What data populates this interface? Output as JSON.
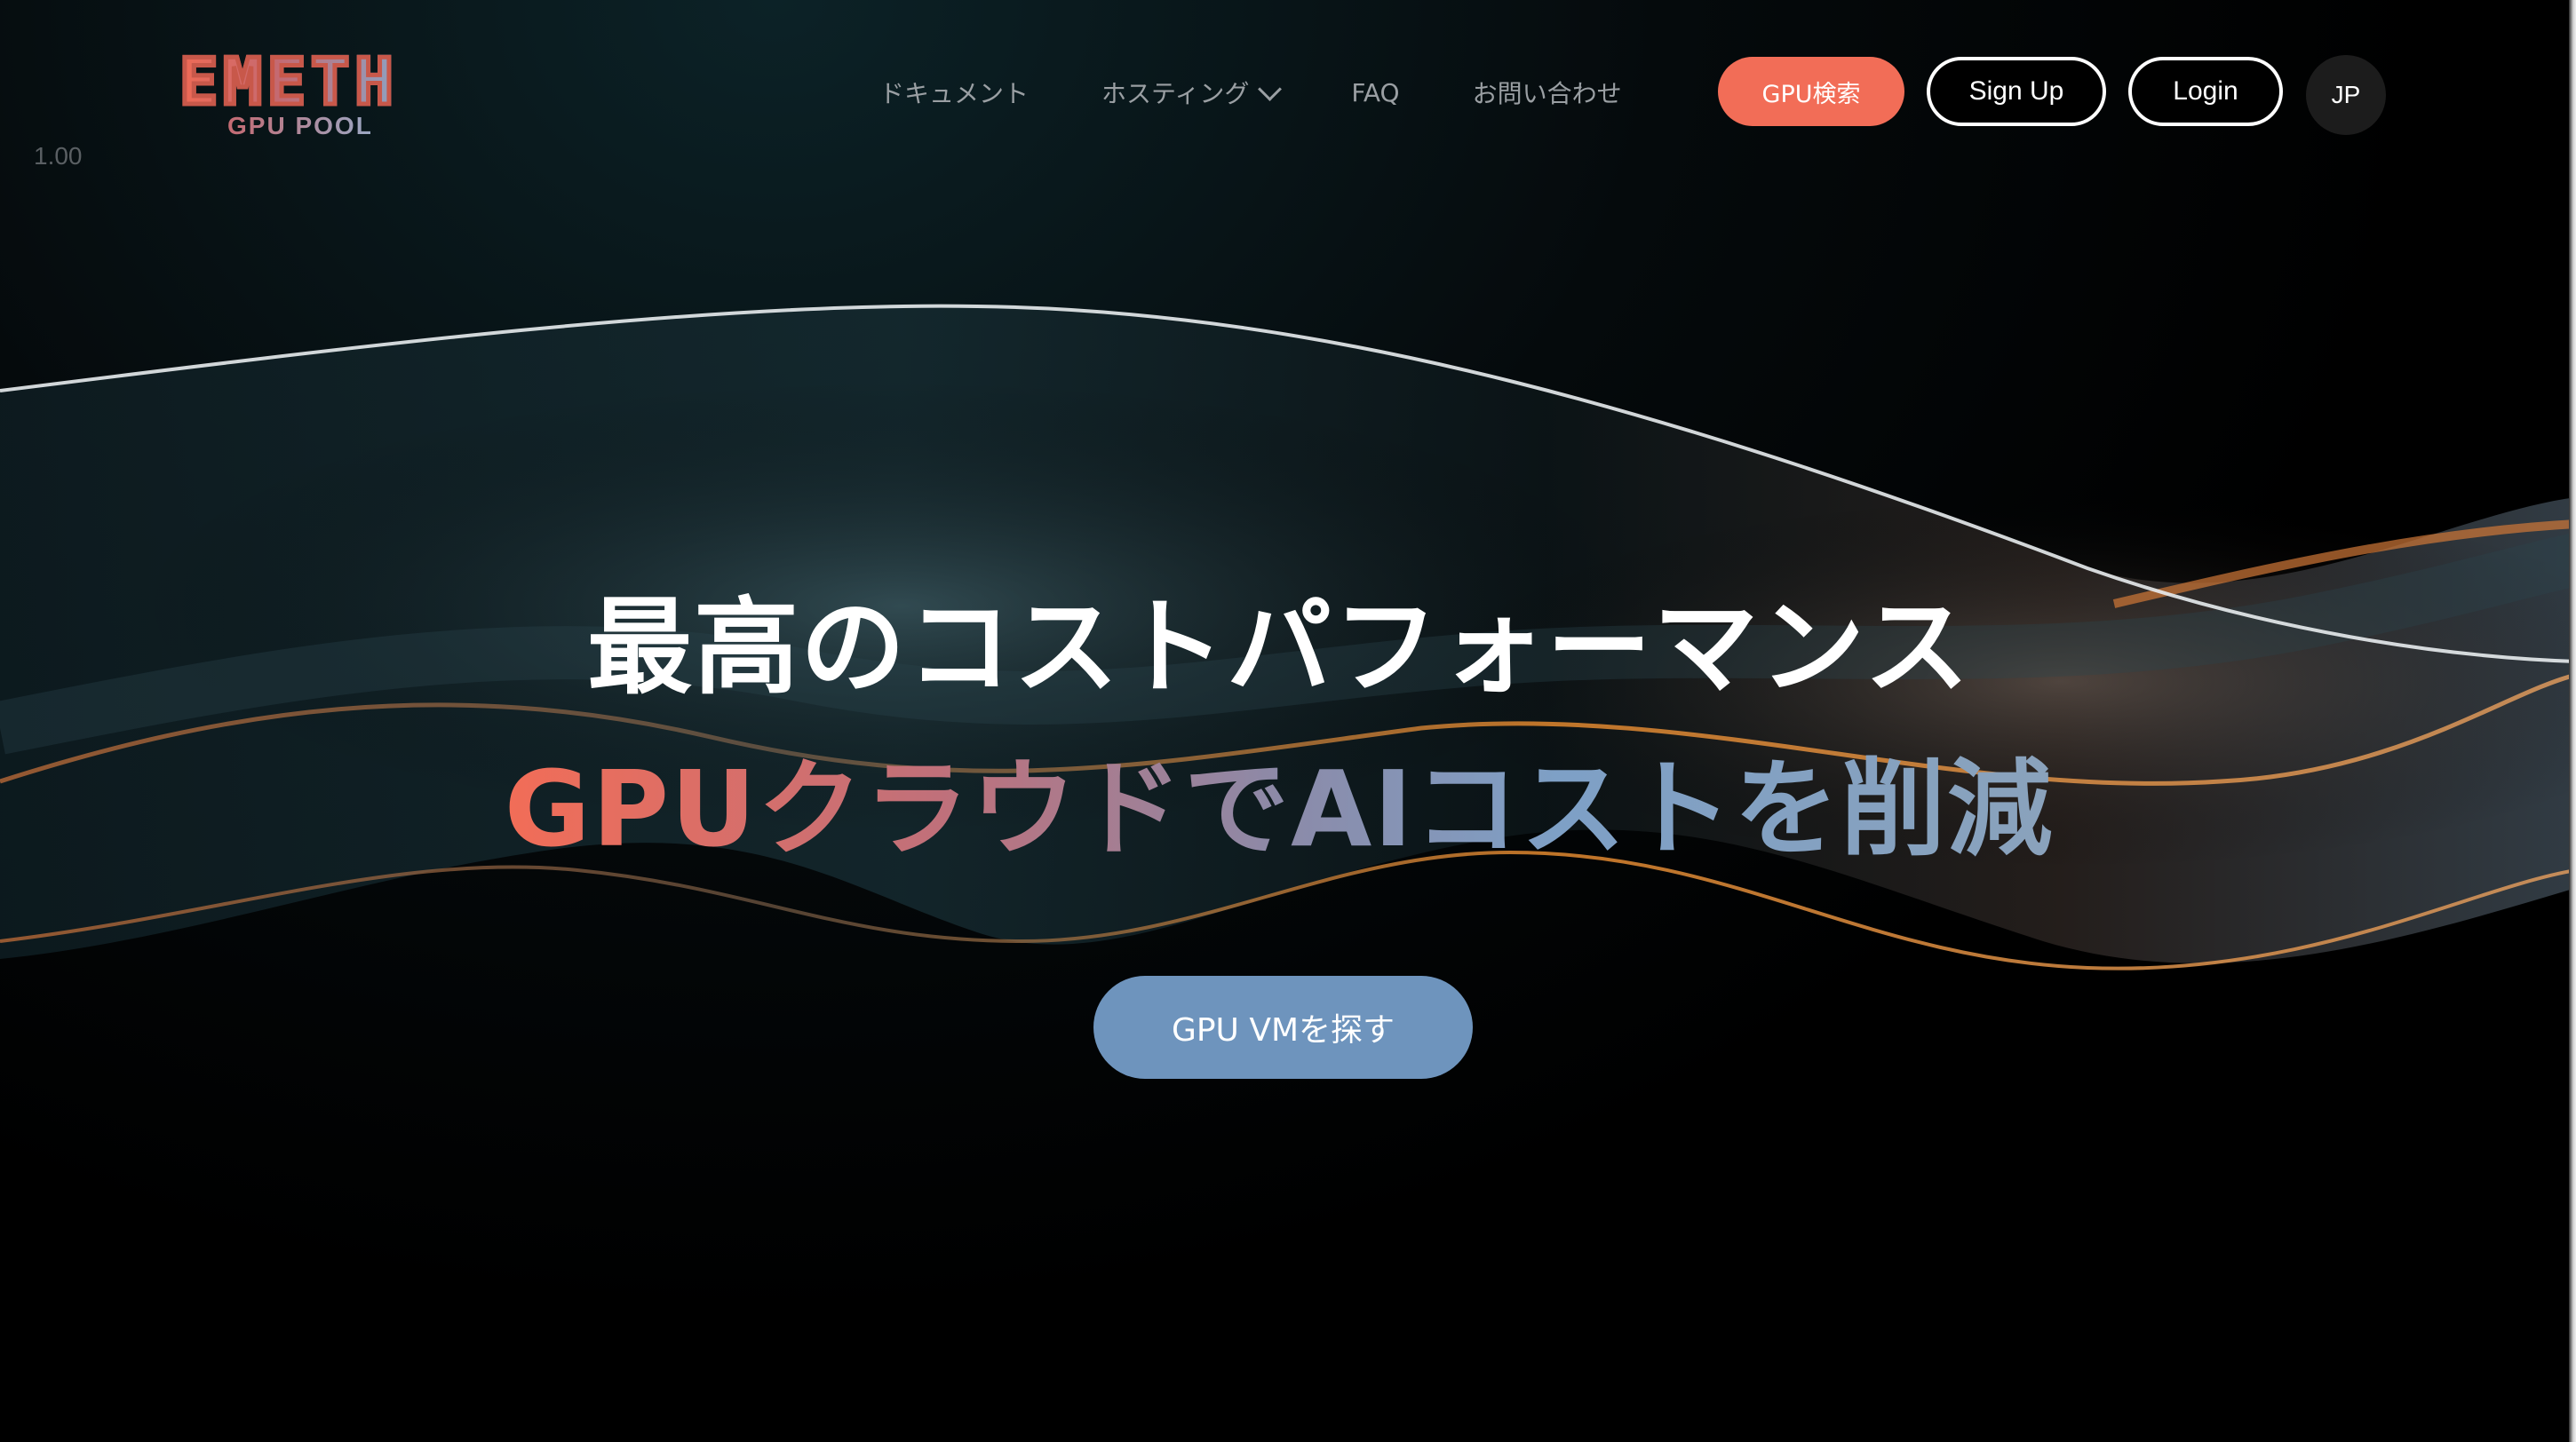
{
  "header": {
    "logo_text": "EMETH",
    "logo_sub": "GPU POOL",
    "version": "1.00",
    "nav": [
      {
        "label": "ドキュメント"
      },
      {
        "label": "ホスティング",
        "has_dropdown": true
      },
      {
        "label": "FAQ"
      },
      {
        "label": "お問い合わせ"
      }
    ],
    "gpu_search_label": "GPU検索",
    "signup_label": "Sign Up",
    "login_label": "Login",
    "language": "JP"
  },
  "hero": {
    "title": "最高のコストパフォーマンス",
    "subtitle": "GPUクラウドでAIコストを削減",
    "cta_label": "GPU VMを探す"
  },
  "colors": {
    "accent": "#f26d57",
    "cta": "#6e94bd",
    "background": "#000000"
  }
}
